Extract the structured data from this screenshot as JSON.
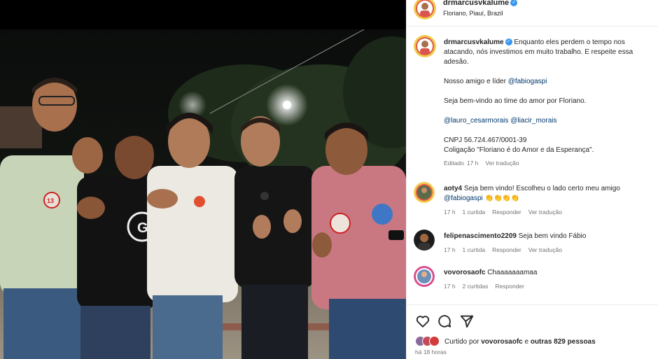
{
  "header": {
    "username": "drmarcusvkalume",
    "location": "Floriano, Piauí, Brazil"
  },
  "caption": {
    "username": "drmarcusvkalume",
    "line1": "Enquanto eles perdem o tempo nos atacando, nós investimos em muito trabalho. E respeite essa adesão.",
    "line2_prefix": "Nosso amigo e líder ",
    "line2_mention": "@fabiogaspi",
    "line3": "Seja bem-vindo ao time do amor por Floriano.",
    "mention1": "@lauro_cesarmorais",
    "mention2": "@liacir_morais",
    "cnpj": "CNPJ 56.724.467/0001-39",
    "coligacao": "Coligação \"Floriano é do Amor e da Esperança\".",
    "edited": "Editado",
    "time": "17 h",
    "translate": "Ver tradução"
  },
  "comments": [
    {
      "username": "aoty4",
      "text": "Seja bem vindo! Escolheu o lado certo meu amigo",
      "mention": "@fabiogaspi",
      "emoji": "👏👏👏👏",
      "time": "17 h",
      "likes": "1 curtida",
      "reply": "Responder",
      "translate": "Ver tradução"
    },
    {
      "username": "felipenascimento2209",
      "text": "Seja bem vindo Fábio",
      "time": "17 h",
      "likes": "1 curtida",
      "reply": "Responder",
      "translate": "Ver tradução"
    },
    {
      "username": "vovorosaofc",
      "text": "Chaaaaaaamaa",
      "time": "17 h",
      "likes": "2 curtidas",
      "reply": "Responder"
    }
  ],
  "actions": {
    "liked_prefix": "Curtido por ",
    "liked_user": "vovorosaofc",
    "liked_middle": " e ",
    "liked_others": "outras 829 pessoas",
    "posted_ago": "há 18 horas"
  },
  "photo": {
    "badge_number": "13",
    "shirt_logo": "G"
  },
  "colors": {
    "verified": "#3897f0",
    "link": "#00376b",
    "muted": "#737373"
  },
  "icons": [
    "heart-icon",
    "comment-icon",
    "share-icon",
    "verified-icon"
  ]
}
